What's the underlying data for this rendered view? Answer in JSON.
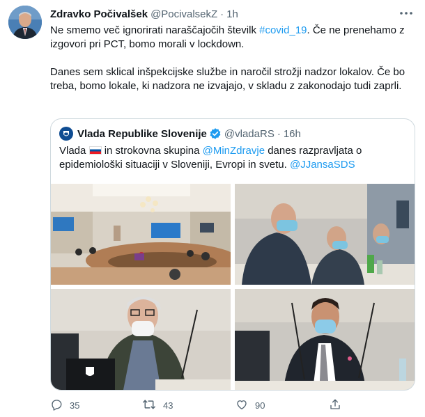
{
  "author": {
    "display_name": "Zdravko Počivalšek",
    "handle": "@PocivalsekZ",
    "separator": "·",
    "time": "1h"
  },
  "tweet": {
    "p1_before": "Ne smemo več ignorirati naraščajočih številk ",
    "hashtag": "#covid_19",
    "p1_after": ". Če ne prenehamo z izgovori pri PCT, bomo morali v lockdown.",
    "p2": "Danes sem sklical inšpekcijske službe in naročil strožji nadzor lokalov. Če bo treba, bomo lokale, ki nadzora ne izvajajo, v skladu z zakonodajo tudi zaprli."
  },
  "quote": {
    "display_name": "Vlada Republike Slovenije",
    "handle": "@vladaRS",
    "separator": "·",
    "time": "16h",
    "text_a": "Vlada ",
    "text_b": " in strokovna skupina ",
    "mention1": "@MinZdravje",
    "text_c": " danes razpravljata o epidemiološki situaciji v Sloveniji, Evropi in svetu. ",
    "mention2": "@JJansaSDS",
    "flag_icon": "slovenia-flag-icon"
  },
  "actions": {
    "reply_count": "35",
    "retweet_count": "43",
    "like_count": "90"
  },
  "colors": {
    "accent": "#1d9bf0",
    "text_primary": "#0f1419",
    "text_secondary": "#536471",
    "border": "#cfd9de"
  },
  "icons": [
    "more-icon",
    "verified-icon",
    "reply-icon",
    "retweet-icon",
    "like-icon",
    "share-icon"
  ]
}
